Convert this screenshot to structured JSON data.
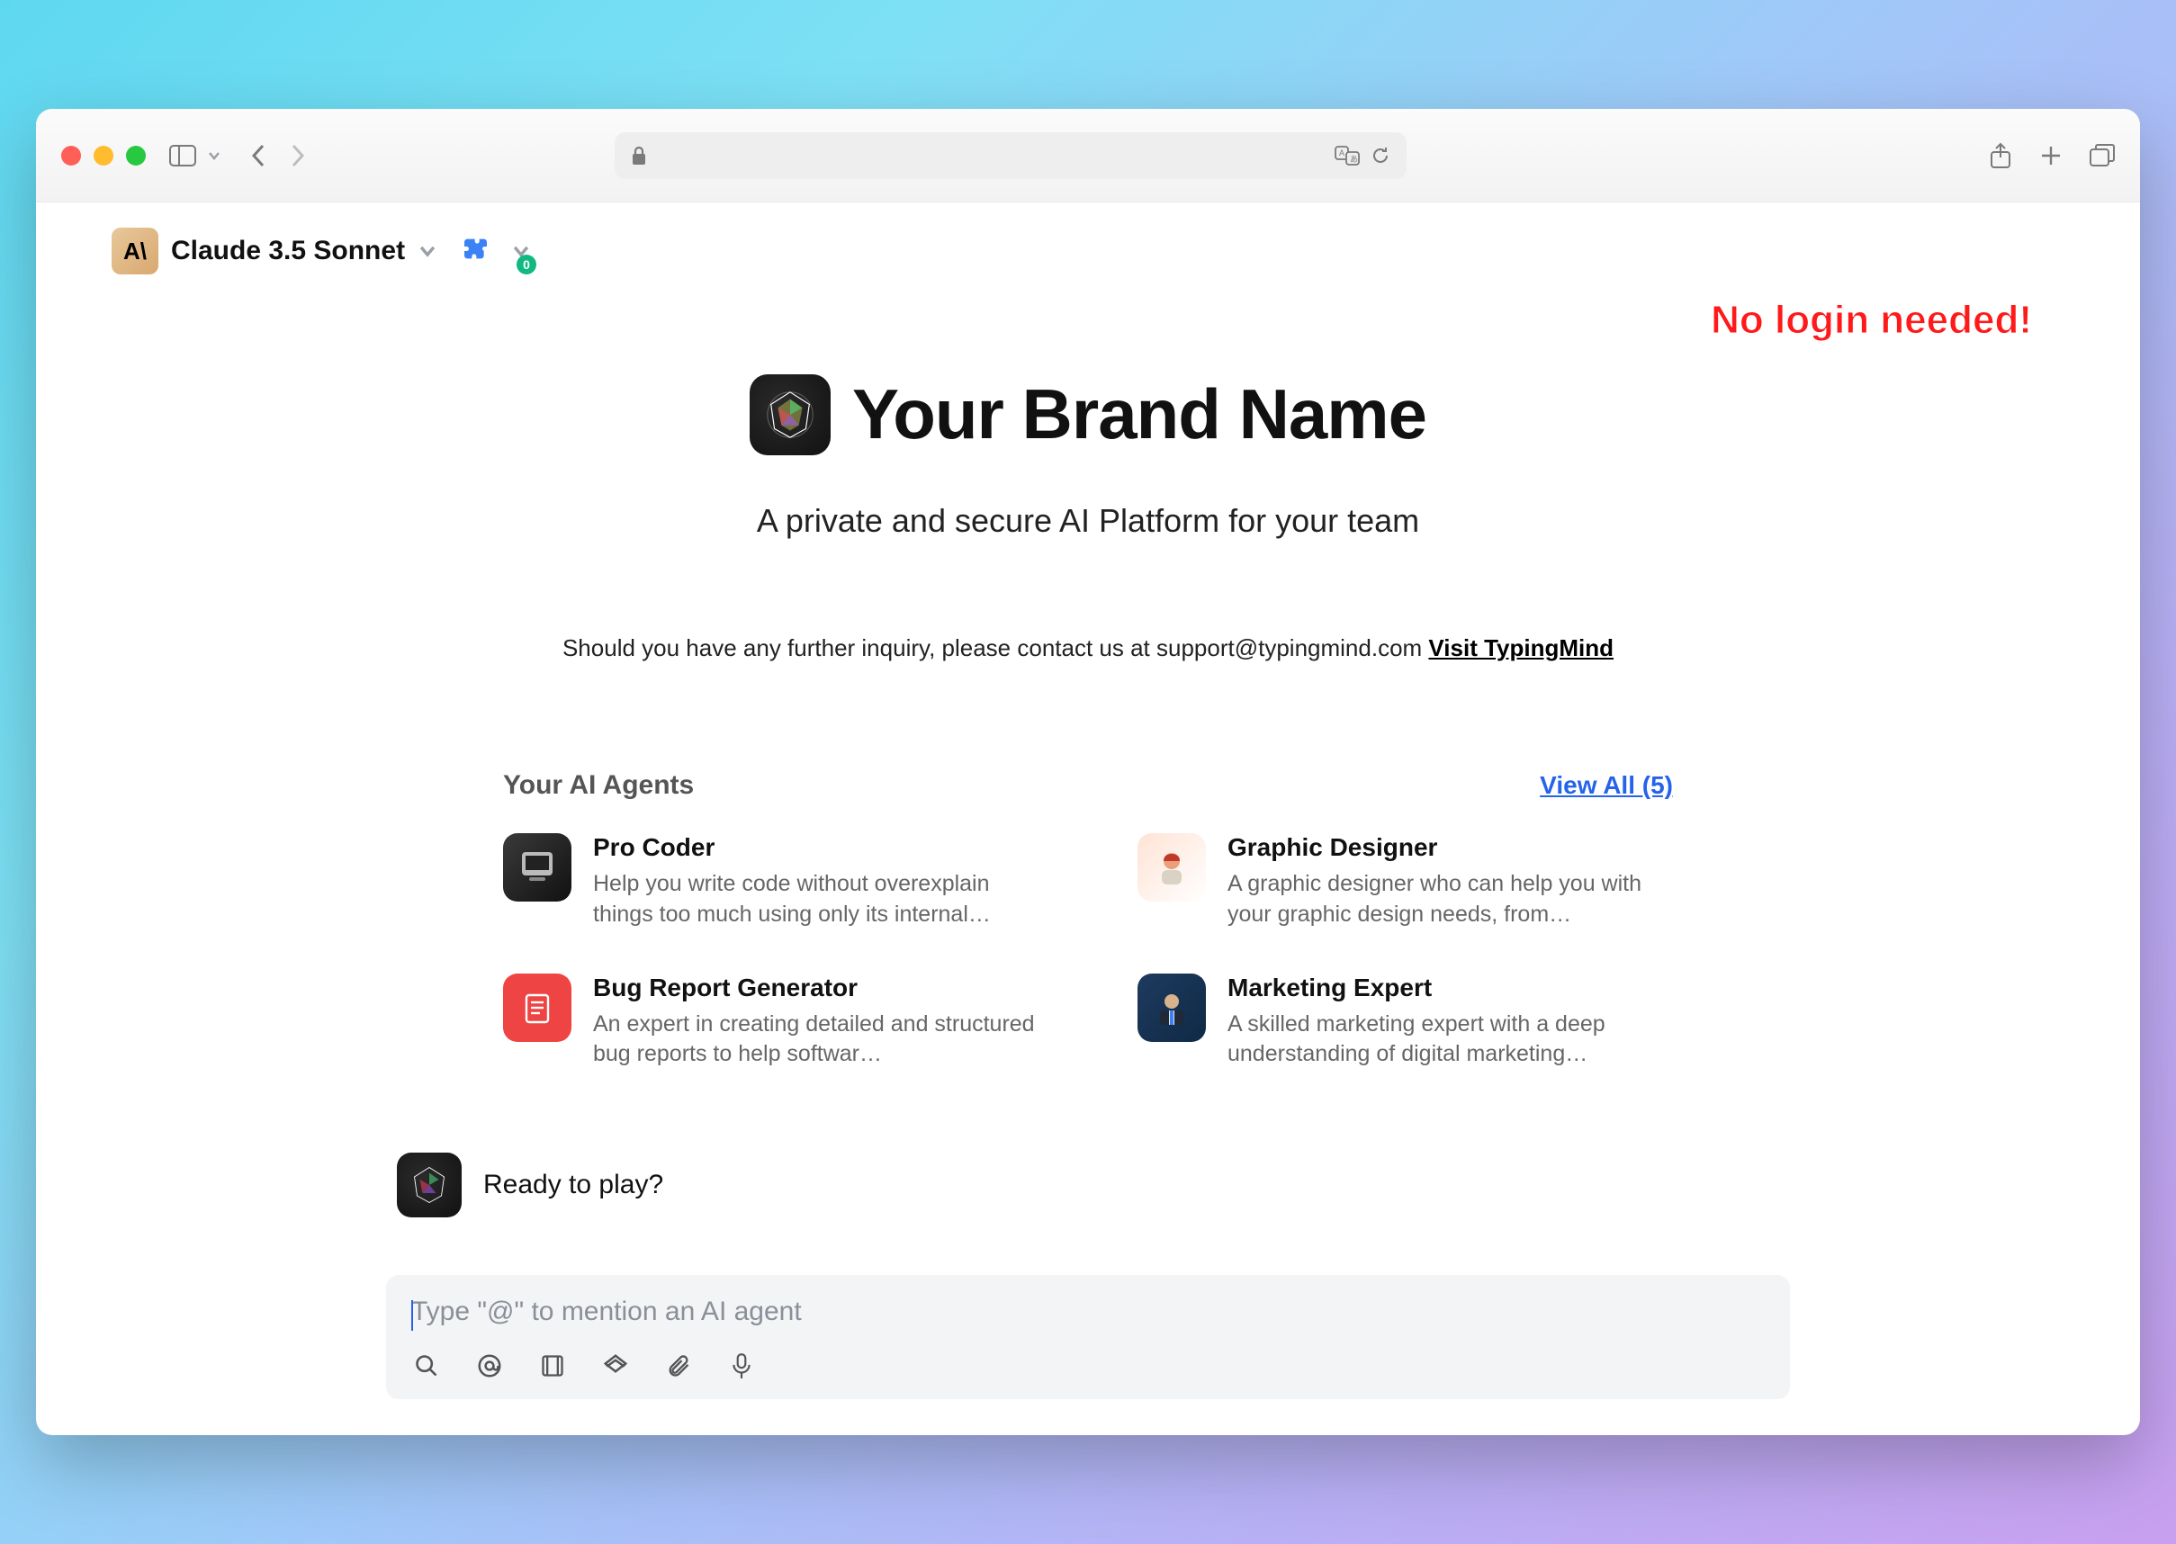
{
  "chrome": {
    "url_domain": ""
  },
  "model": {
    "name": "Claude 3.5 Sonnet",
    "logo_text": "A\\"
  },
  "plugins": {
    "count": "0"
  },
  "annotation": "No login needed!",
  "hero": {
    "title": "Your Brand Name",
    "subtitle": "A private and secure AI Platform for your team",
    "contact_prefix": "Should you have any further inquiry, please contact us at support@typingmind.com ",
    "visit_link": "Visit TypingMind"
  },
  "agents": {
    "title": "Your AI Agents",
    "view_all": "View All (5)",
    "items": [
      {
        "name": "Pro Coder",
        "desc": "Help you write code without overexplain things too much using only its internal…"
      },
      {
        "name": "Graphic Designer",
        "desc": "A graphic designer who can help you with your graphic design needs, from…"
      },
      {
        "name": "Bug Report Generator",
        "desc": "An expert in creating detailed and structured bug reports to help softwar…"
      },
      {
        "name": "Marketing Expert",
        "desc": "A skilled marketing expert with a deep understanding of digital marketing…"
      }
    ]
  },
  "system_prompt": "Ready to play?",
  "composer": {
    "placeholder": "Type \"@\" to mention an AI agent"
  }
}
